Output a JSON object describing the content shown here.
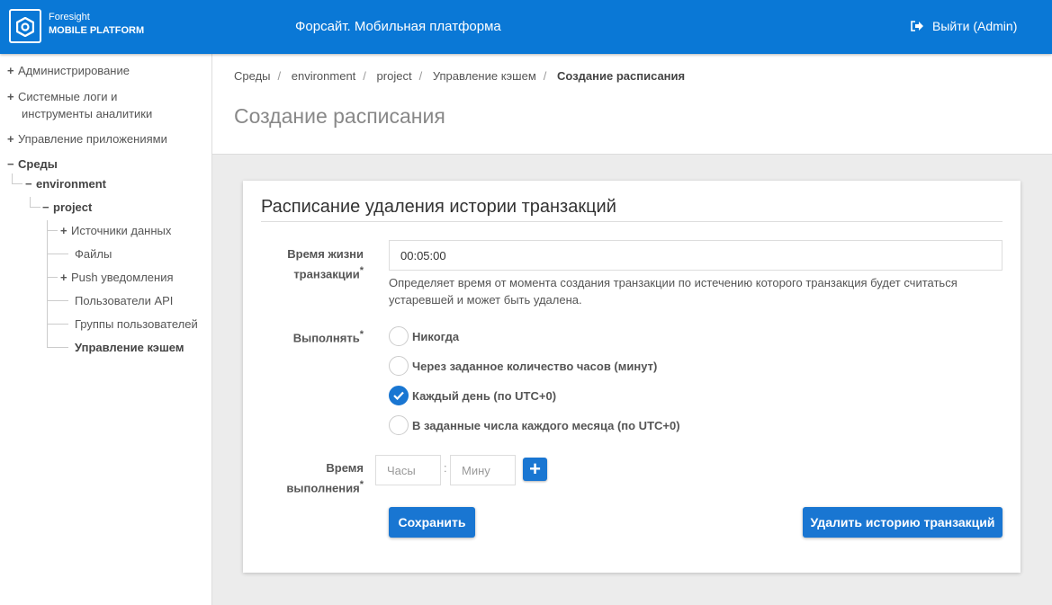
{
  "header": {
    "brand_top": "Foresight",
    "brand_bottom": "MOBILE PLATFORM",
    "app_title": "Форсайт. Мобильная платформа",
    "logout": "Выйти (Admin)",
    "accent": "#0a78d6"
  },
  "sidebar": {
    "items": [
      "Администрирование",
      "Системные логи и",
      "инструменты аналитики",
      "Управление приложениями",
      "Среды",
      "environment",
      "project",
      "Источники данных",
      "Файлы",
      "Push уведомления",
      "Пользователи API",
      "Группы пользователей",
      "Управление кэшем"
    ]
  },
  "breadcrumb": [
    "Среды",
    "environment",
    "project",
    "Управление кэшем",
    "Создание расписания"
  ],
  "page_title": "Создание расписания",
  "form": {
    "title": "Расписание удаления истории транзакций",
    "lifetime_label_1": "Время жизни",
    "lifetime_label_2": "транзакции",
    "lifetime_value": "00:05:00",
    "lifetime_hint": "Определяет время от момента создания транзакции по истечению которого транзакция будет считаться устаревшей и может быть удалена.",
    "run_label": "Выполнять",
    "options": [
      "Никогда",
      "Через заданное количество часов (минут)",
      "Каждый день (по UTC+0)",
      "В заданные числа каждого месяца (по UTC+0)"
    ],
    "selected": 2,
    "time_label_1": "Время",
    "time_label_2": "выполнения",
    "hours_placeholder": "Часы",
    "minutes_placeholder": "Мину",
    "colon": ":",
    "plus": "+",
    "required": "*",
    "save": "Сохранить",
    "delete": "Удалить историю транзакций"
  }
}
